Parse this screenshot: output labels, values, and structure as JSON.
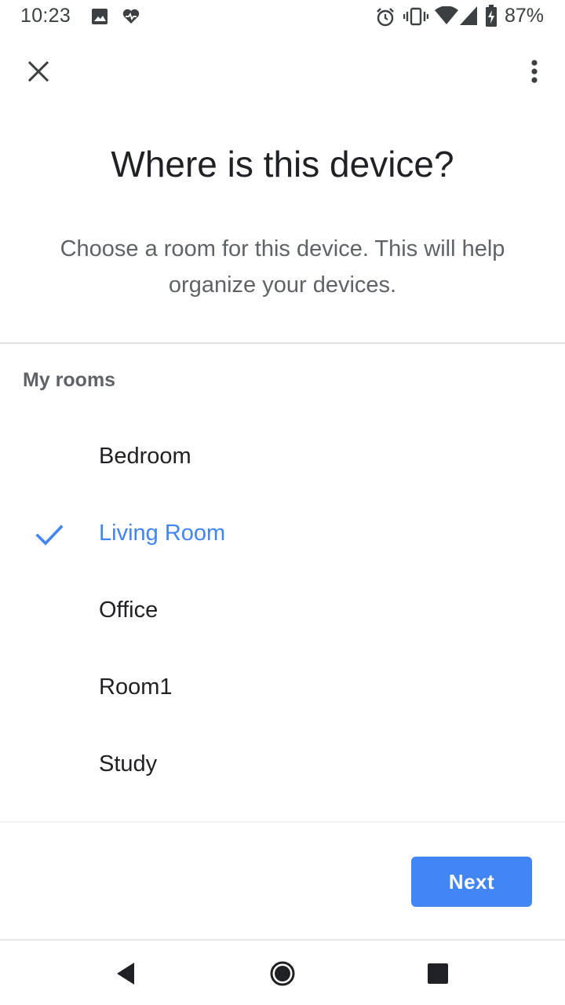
{
  "status_bar": {
    "time": "10:23",
    "battery_percent": "87%",
    "icons": [
      "image-icon",
      "heart-pulse-icon",
      "alarm-icon",
      "vibrate-icon",
      "wifi-icon",
      "signal-icon",
      "battery-charging-icon"
    ]
  },
  "app_bar": {
    "close_icon": "close-icon",
    "more_icon": "more-vert-icon"
  },
  "header": {
    "title": "Where is this device?",
    "subtitle": "Choose a room for this device. This will help organize your devices."
  },
  "rooms": {
    "section_label": "My rooms",
    "items": [
      {
        "label": "Bedroom",
        "selected": false
      },
      {
        "label": "Living Room",
        "selected": true
      },
      {
        "label": "Office",
        "selected": false
      },
      {
        "label": "Room1",
        "selected": false
      },
      {
        "label": "Study",
        "selected": false
      }
    ]
  },
  "footer": {
    "next_label": "Next"
  },
  "colors": {
    "accent": "#4285f4",
    "text_primary": "#202124",
    "text_secondary": "#5f6368"
  },
  "nav_bar": {
    "icons": [
      "back-icon",
      "home-icon",
      "recents-icon"
    ]
  }
}
